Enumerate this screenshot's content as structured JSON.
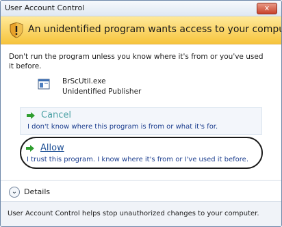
{
  "window": {
    "title": "User Account Control",
    "close_label": "x"
  },
  "banner": {
    "heading": "An unidentified program wants access to your computer",
    "icon": "uac-shield-warning-icon"
  },
  "warning_text": "Don't run the program unless you know where it's from or you've used it before.",
  "program": {
    "name": "BrScUtil.exe",
    "publisher": "Unidentified Publisher",
    "icon": "application-icon"
  },
  "options": {
    "cancel": {
      "title": "Cancel",
      "description": "I don't know where this program is from or what it's for."
    },
    "allow": {
      "title": "Allow",
      "description": "I trust this program. I know where it's from or I've used it before."
    }
  },
  "details": {
    "label": "Details"
  },
  "footer": {
    "text": "User Account Control helps stop unauthorized changes to your computer."
  },
  "colors": {
    "banner": "#f6c43c",
    "link": "#1d4f95",
    "arrow": "#2f9e2f"
  }
}
